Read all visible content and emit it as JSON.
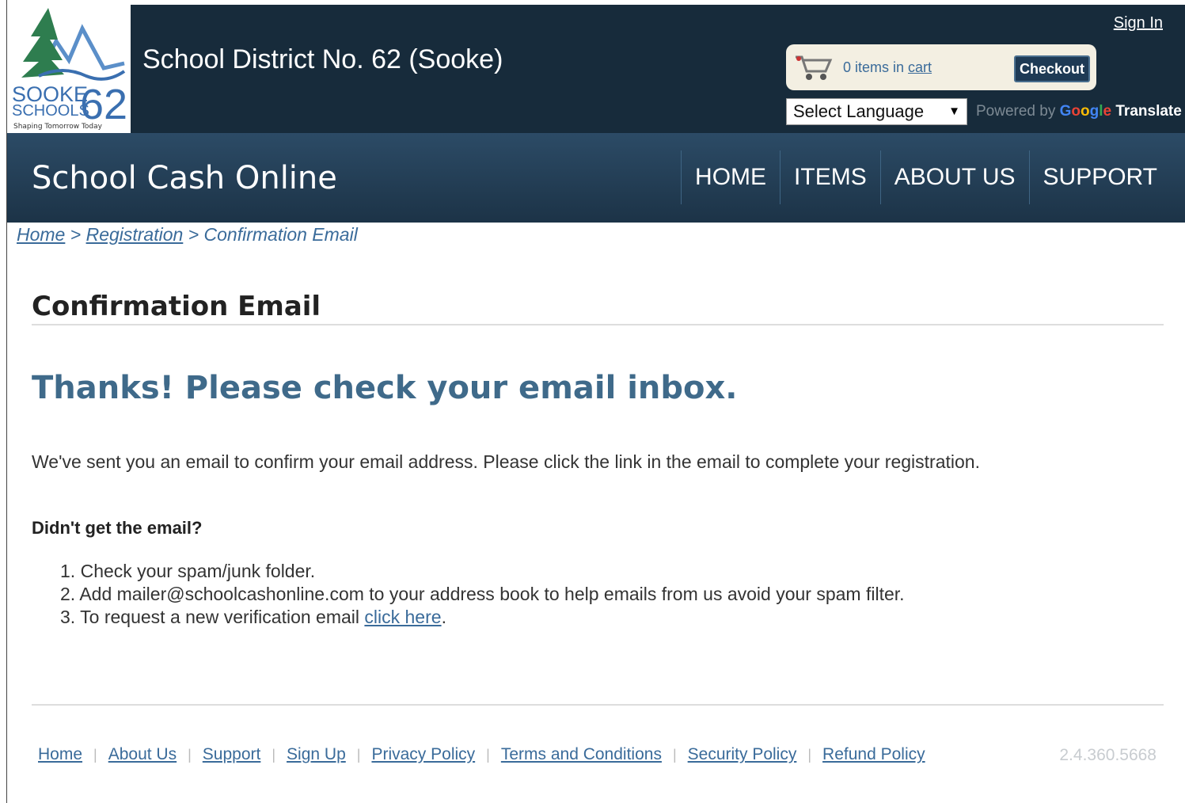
{
  "header": {
    "logo": {
      "line1": "SOOKE",
      "line2": "SCHOOLS",
      "number": "62",
      "tagline": "Shaping Tomorrow Today"
    },
    "district_title": "School District No. 62 (Sooke)",
    "sign_in": "Sign In",
    "cart": {
      "count_text": "0 items in",
      "link_text": "cart",
      "checkout_label": "Checkout"
    },
    "language": {
      "selected": "Select Language",
      "powered_by": "Powered by",
      "brand_letters": [
        "G",
        "o",
        "o",
        "g",
        "l",
        "e"
      ],
      "translate": "Translate"
    }
  },
  "nav": {
    "brand": "School Cash Online",
    "items": [
      "HOME",
      "ITEMS",
      "ABOUT US",
      "SUPPORT"
    ]
  },
  "breadcrumb": {
    "home": "Home",
    "sep1": ">",
    "registration": "Registration",
    "sep2": ">",
    "current": "Confirmation Email"
  },
  "main": {
    "page_title": "Confirmation Email",
    "headline": "Thanks! Please check your email inbox.",
    "message": "We've sent you an email to confirm your email address. Please click the link in the email to complete your registration.",
    "subhead": "Didn't get the email?",
    "help_items": [
      {
        "num": "1.",
        "text": "Check your spam/junk folder."
      },
      {
        "num": "2.",
        "text": "Add mailer@schoolcashonline.com to your address book to help emails from us avoid your spam filter."
      },
      {
        "num": "3.",
        "text": "To request a new verification email ",
        "link": "click here",
        "tail": "."
      }
    ]
  },
  "footer": {
    "links": [
      "Home",
      "About Us",
      "Support",
      "Sign Up",
      "Privacy Policy",
      "Terms and Conditions",
      "Security Policy",
      "Refund Policy"
    ],
    "separator": "|",
    "version": "2.4.360.5668"
  },
  "colors": {
    "header_bg": "#172b3b",
    "nav_bg": "#2c4b66",
    "link": "#3a6b9a",
    "headline": "#3f6a8a"
  }
}
